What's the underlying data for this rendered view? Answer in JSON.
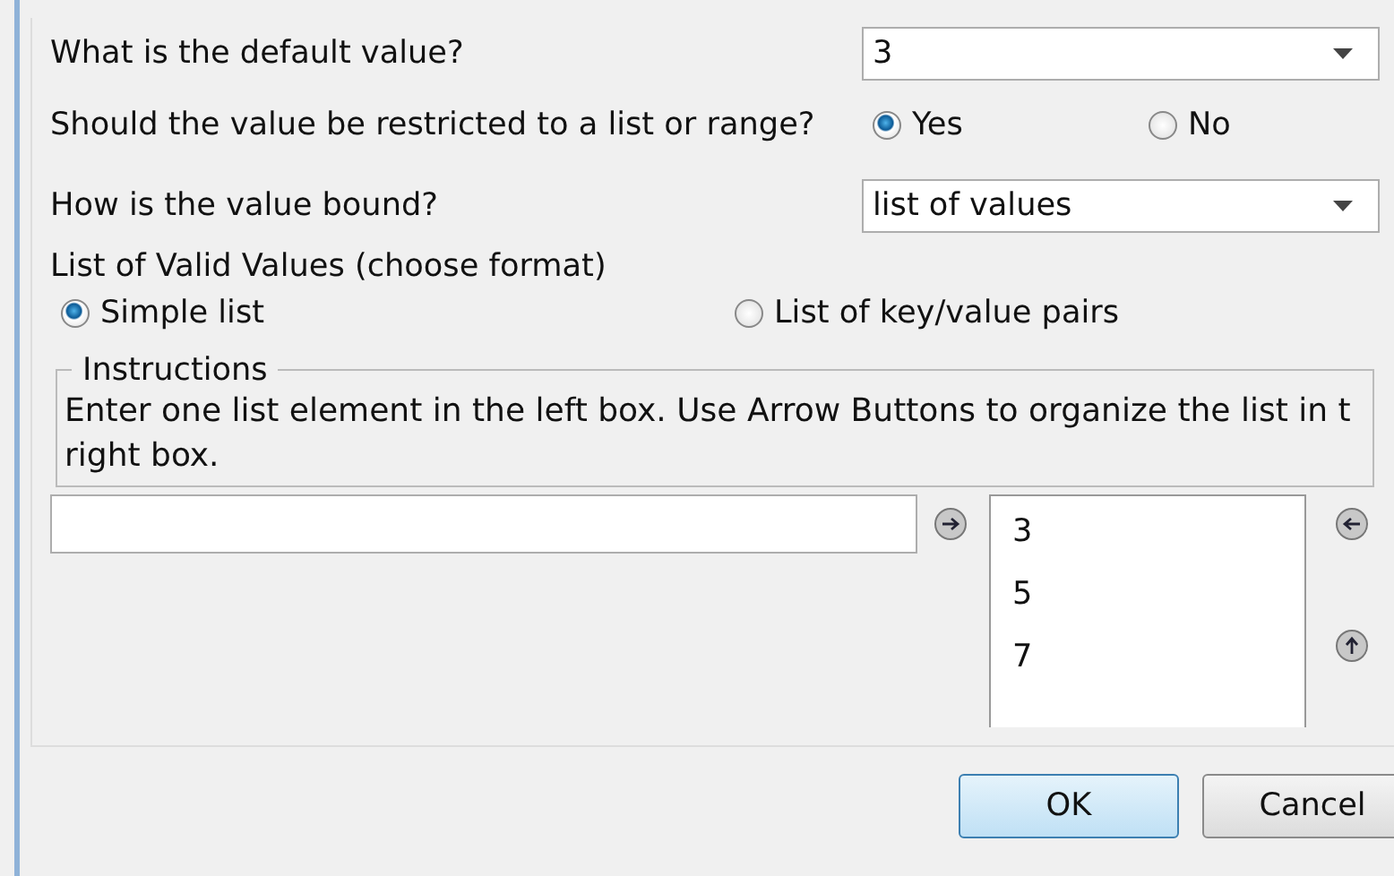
{
  "questions": [
    {
      "kind": "dropdown",
      "label": "What is the default value?",
      "value": "3"
    },
    {
      "kind": "radio",
      "label": "Should the value be restricted to a list or range?",
      "options": [
        {
          "label": "Yes",
          "selected": true
        },
        {
          "label": "No",
          "selected": false
        }
      ]
    },
    {
      "kind": "dropdown",
      "label": "How is the value bound?",
      "value": "list of values"
    }
  ],
  "format": {
    "label": "List of Valid Values (choose format)",
    "options": [
      {
        "label": "Simple list",
        "selected": true
      },
      {
        "label": "List of key/value pairs",
        "selected": false
      }
    ]
  },
  "instructions": {
    "legend": "Instructions",
    "lines": [
      "Enter one list element in the left box. Use Arrow Buttons to organize the list in t",
      "right box."
    ]
  },
  "list_editor": {
    "values": [
      "3",
      "5",
      "7"
    ]
  },
  "buttons": [
    {
      "label": "OK",
      "default": true
    },
    {
      "label": "Cancel",
      "default": false
    }
  ]
}
